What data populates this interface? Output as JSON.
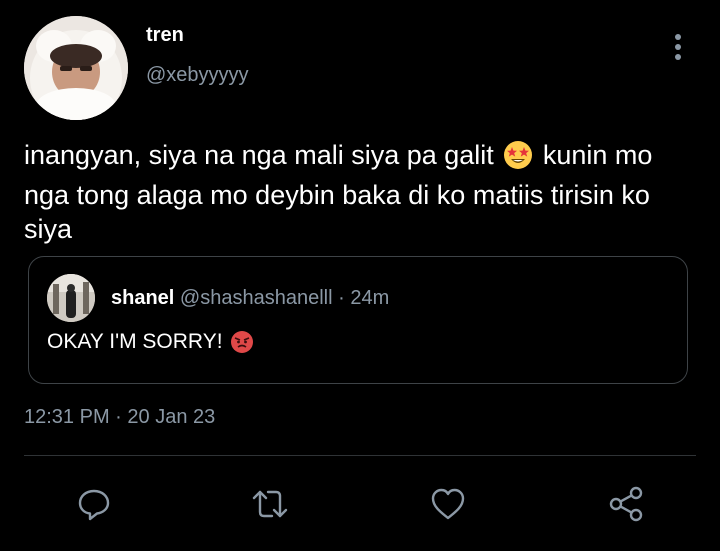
{
  "author": {
    "name": "tren",
    "handle": "@xebyyyyy"
  },
  "tweet": {
    "text_before_emoji": "inangyan, siya na nga mali siya pa galit",
    "emoji": "star-struck",
    "text_after_emoji": "kunin mo nga tong alaga mo deybin baka di ko matiis tirisin ko siya"
  },
  "quote": {
    "name": "shanel",
    "handle": "@shashashanelll",
    "separator": "·",
    "time": "24m",
    "text": "OKAY I'M SORRY!",
    "emoji": "angry-face"
  },
  "timestamp": {
    "time": "12:31 PM",
    "separator": "·",
    "date": "20 Jan 23"
  },
  "actions": [
    "reply-icon",
    "retweet-icon",
    "like-icon",
    "share-icon"
  ],
  "colors": {
    "background": "#000000",
    "text": "#ffffff",
    "secondary": "#8b98a5",
    "border": "#3e4347",
    "emoji_yellow": "#ffcc4d",
    "emoji_red": "#e04848"
  }
}
